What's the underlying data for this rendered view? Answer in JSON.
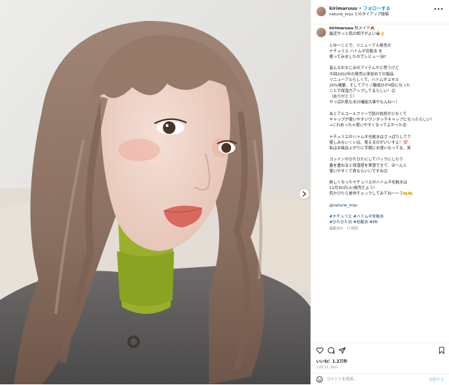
{
  "post_header": {
    "username": "kirimaruuu",
    "separator": "•",
    "follow_label": "フォローする",
    "subtitle": "naturie_imju とのタイアップ投稿",
    "more_label": "•••"
  },
  "caption": {
    "username": "kirimaruuu",
    "first_line": "秋メイク🍂",
    "lines": [
      "最近やっと肌の調子がよい😭👌",
      "",
      "とゆーことで、リニューアル発売の",
      "ナチュリエ ハトムギ化粧水 を",
      "使ってみましたのでレビュー😘‼",
      "",
      "皆んなおなじみのアイテムやと思うけど",
      "今回2002年の発売以来初めての製品",
      "リニューアルらしくて、ハトムギエキス",
      "20%増量、そしてアミノ酸成分が4倍になった",
      "ことで保湿力アップしてるらしい！😊",
      "（ありがとう）",
      "やっぱお肌も水分補給大事やもんね～！",
      "",
      "あとアルコールフリーで肌の負担が少なくて",
      "キャップが使いやすいワンタッチキャップになったらしい！",
      "→これめっちゃ使いやすくなってよかった😍",
      "",
      "ナチュリエのハトムギ化粧水はさっぱりしてて",
      "使しみないくいは、使えるのがいいすよ！💯",
      "私はお風呂上がりに手軽にお使いなってる、笑",
      "",
      "コットンのひたひたにしてパックにしたり",
      "量を重ねると保湿感を実感できて、ほーんと",
      "使いやすくて貢ならいいですね😊",
      "",
      "新しくなったナチュリエのハトムギ化粧水は",
      "11月30日(火)発売だよう！",
      "気かけたら是非チェックしてみてね〜〜う🍋🍋"
    ],
    "mention": "@naturie_imju",
    "hashtags_line1": "#ナチュリエ #ハトムギ化粧水",
    "hashtags_line2": "#ひたひた日 #化粧水 #PR",
    "meta": "編集済み · 17週間"
  },
  "stats": {
    "likes": "いいね！1.2万件",
    "date": "11月 25, 2021"
  },
  "comment": {
    "placeholder": "コメントを追加...",
    "post_label": "投稿する"
  },
  "icons": [
    "heart-icon",
    "comment-icon",
    "share-icon",
    "bookmark-icon",
    "emoji-icon",
    "next-arrow-icon",
    "more-icon"
  ],
  "colors": {
    "link": "#0095f6",
    "mention": "#00376b",
    "muted": "#8e8e8e",
    "border": "#efefef",
    "post_disabled": "#b2dffc"
  }
}
